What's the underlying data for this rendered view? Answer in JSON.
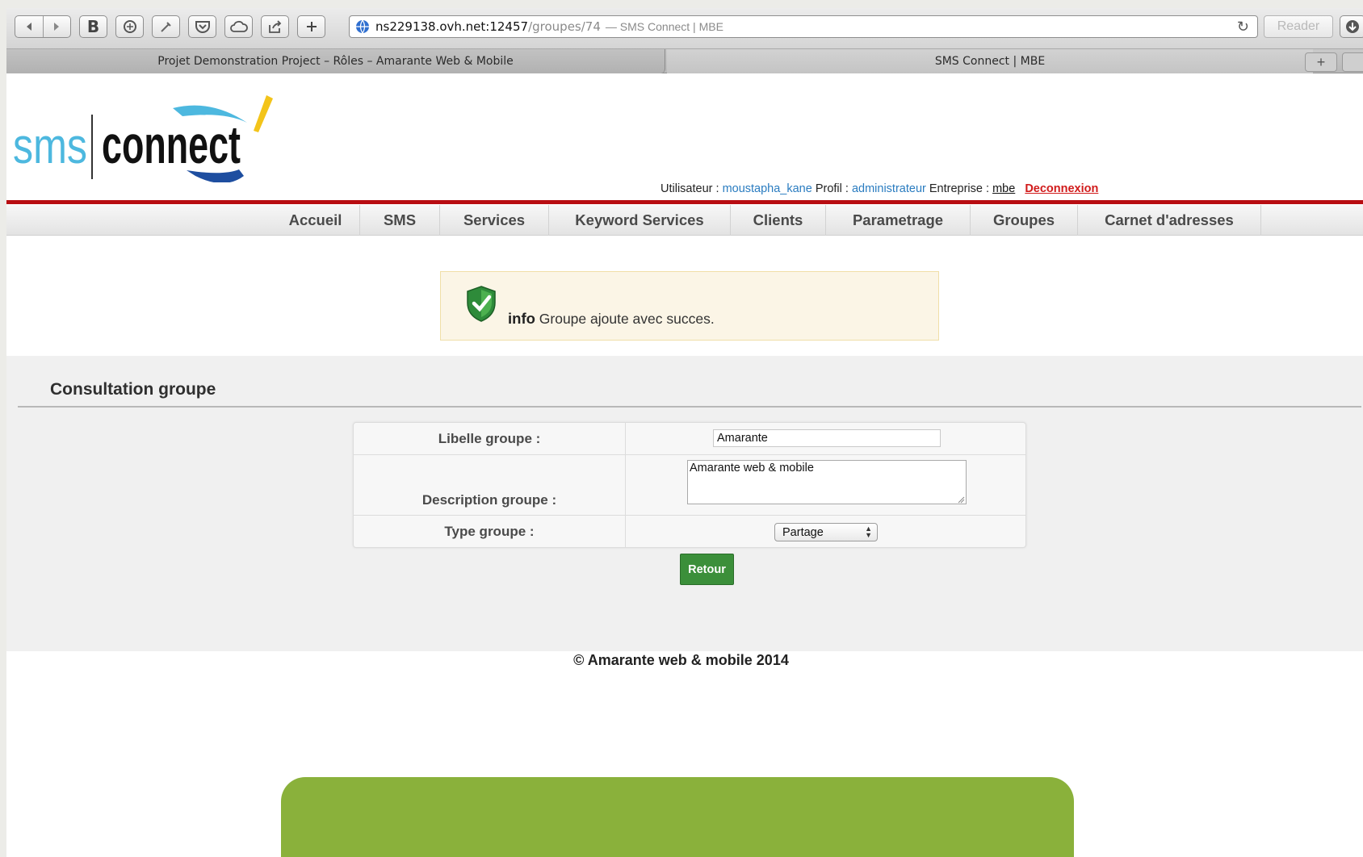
{
  "browser": {
    "url_host": "ns229138.ovh.net:12457",
    "url_path": "/groupes/74",
    "url_title": "— SMS Connect | MBE",
    "reader_label": "Reader",
    "tabs": [
      {
        "label": "Projet Demonstration Project – Rôles – Amarante Web & Mobile"
      },
      {
        "label": "SMS Connect | MBE"
      }
    ],
    "toolbar_icons": [
      "back-icon",
      "forward-icon",
      "bold-b-icon",
      "evernote-icon",
      "tool-icon",
      "pocket-icon",
      "cloud-icon",
      "share-icon",
      "plus-icon",
      "globe-icon",
      "reload-icon",
      "download-icon"
    ]
  },
  "header": {
    "logo_alt": "sms connect",
    "user_label": "Utilisateur :",
    "user_value": "moustapha_kane",
    "profile_label": "Profil :",
    "profile_value": "administrateur",
    "company_label": "Entreprise :",
    "company_value": "mbe",
    "logout_label": "Deconnexion",
    "accent_color": "#b80d12"
  },
  "nav": {
    "items": [
      {
        "label": "Accueil"
      },
      {
        "label": "SMS"
      },
      {
        "label": "Services"
      },
      {
        "label": "Keyword Services"
      },
      {
        "label": "Clients"
      },
      {
        "label": "Parametrage"
      },
      {
        "label": "Groupes"
      },
      {
        "label": "Carnet d'adresses"
      }
    ]
  },
  "notice": {
    "prefix": "info",
    "message": "Groupe ajoute avec succes.",
    "icon": "shield-check-icon"
  },
  "content": {
    "title": "Consultation groupe",
    "form": {
      "libelle_label": "Libelle groupe :",
      "libelle_value": "Amarante",
      "description_label": "Description groupe :",
      "description_value": "Amarante web & mobile",
      "type_label": "Type groupe :",
      "type_value": "Partage"
    },
    "back_button": "Retour"
  },
  "footer": {
    "copyright": "© Amarante web & mobile 2014"
  }
}
